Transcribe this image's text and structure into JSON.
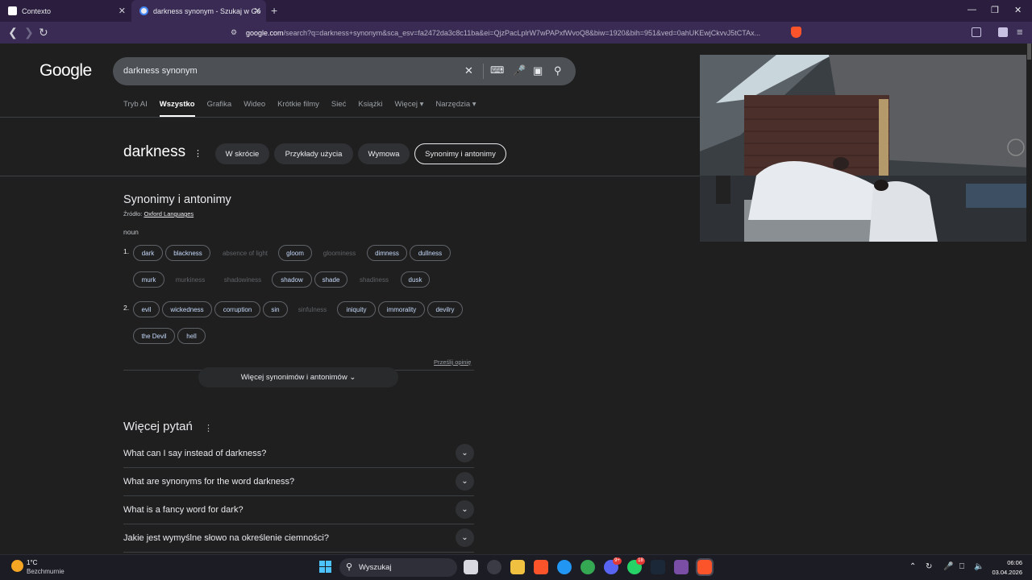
{
  "browser": {
    "tabs": [
      {
        "title": "Contexto"
      },
      {
        "title": "darkness synonym - Szukaj w Go"
      }
    ],
    "tab_close": "✕",
    "new_tab": "+",
    "window_controls": {
      "minimize": "—",
      "maximize": "❐",
      "close": "✕"
    },
    "url_host": "google.com",
    "url_rest": "/search?q=darkness+synonym&sca_esv=fa2472da3c8c11ba&ei=QjzPacLplrW7wPAPxfWvoQ8&biw=1920&bih=951&ved=0ahUKEwjCkvvJ5tCTAx..."
  },
  "google": {
    "logo": "Google",
    "query": "darkness synonym",
    "nav_tabs": [
      "Tryb AI",
      "Wszystko",
      "Grafika",
      "Wideo",
      "Krótkie filmy",
      "Sieć",
      "Książki",
      "Więcej ▾",
      "Narzędzia ▾"
    ],
    "active_tab": "Wszystko"
  },
  "dictionary": {
    "word": "darkness",
    "chips": [
      "W skrócie",
      "Przykłady użycia",
      "Wymowa",
      "Synonimy i antonimy"
    ],
    "selected_chip": "Synonimy i antonimy",
    "section_title": "Synonimy i antonimy",
    "source_label": "Źródło:",
    "source_link": "Oxford Languages",
    "part_of_speech": "noun",
    "sense1_num": "1.",
    "sense2_num": "2.",
    "sense1_row1": [
      "dark",
      "blackness",
      "absence of light",
      "gloom",
      "gloominess",
      "dimness",
      "dullness"
    ],
    "sense1_row2": [
      "murk",
      "murkiness",
      "shadowiness",
      "shadow",
      "shade",
      "shadiness",
      "dusk"
    ],
    "sense2_row1": [
      "evil",
      "wickedness",
      "corruption",
      "sin",
      "sinfulness",
      "iniquity",
      "immorality",
      "devilry"
    ],
    "sense2_row2": [
      "the Devil",
      "hell"
    ],
    "feedback": "Prześlij opinię",
    "more_button": "Więcej synonimów i antonimów ⌄"
  },
  "people_also_ask": {
    "title": "Więcej pytań",
    "questions": [
      "What can I say instead of darkness?",
      "What are synonyms for the word darkness?",
      "What is a fancy word for dark?",
      "Jakie jest wymyślne słowo na określenie ciemności?"
    ]
  },
  "taskbar": {
    "temperature": "1°C",
    "weather": "Bezchmurnie",
    "search_label": "Wyszukaj",
    "badge_discord": "9+",
    "badge_whatsapp": "18",
    "time": "06:06",
    "date": "03.04.2026"
  },
  "colors": {
    "browser_frame": "#2a1d3e",
    "page_bg": "#1f1f1f",
    "link": "#c6dafc"
  }
}
